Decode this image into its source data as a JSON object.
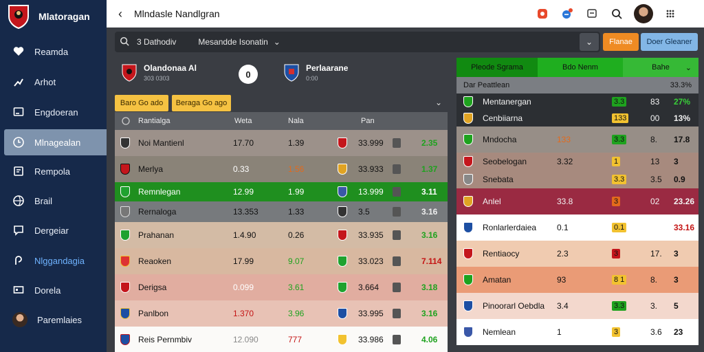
{
  "app": {
    "name": "Mlatoragan"
  },
  "sidebar": {
    "items": [
      {
        "label": "Reamda",
        "icon": "heart-icon"
      },
      {
        "label": "Arhot",
        "icon": "share-icon"
      },
      {
        "label": "Engdoeran",
        "icon": "monitor-icon"
      },
      {
        "label": "Mlnagealan",
        "icon": "clock-icon"
      },
      {
        "label": "Rempola",
        "icon": "copy-icon"
      },
      {
        "label": "Brail",
        "icon": "globe-icon"
      },
      {
        "label": "Dergeiar",
        "icon": "chat-icon"
      },
      {
        "label": "Nlggandagia",
        "icon": "pin-icon"
      },
      {
        "label": "Dorela",
        "icon": "screen-icon"
      },
      {
        "label": "Paremlaies",
        "icon": "user-avatar"
      }
    ]
  },
  "topbar": {
    "title": "Mlndasle Nandlgran"
  },
  "toolbar": {
    "label": "3  Dathodiv",
    "select_value": "Mesandde Isonatin",
    "btn_orange": "Flanae",
    "btn_blue": "Doer Gleaner"
  },
  "match": {
    "home": {
      "name": "Olandonaa Al",
      "sub": "303 0303"
    },
    "away": {
      "name": "Perlaarane",
      "sub": "0:00"
    },
    "vs": "0"
  },
  "filters": {
    "chip1": "Baro Go ado",
    "chip2": "Beraga Go ago"
  },
  "left_table": {
    "headers": [
      "Rantialga",
      "Weta",
      "Nala",
      "Pan"
    ],
    "rows": [
      {
        "name": "Noi  Mantienl",
        "c1": "17.70",
        "c2": "1.39",
        "c3": "33.999",
        "c4": "2.35",
        "bg": "#9c918a",
        "h": 38
      },
      {
        "name": "Merlya",
        "c1": "0.33",
        "c2": "1.56",
        "c3": "33.933",
        "c4": "1.37",
        "bg": "#8a8378",
        "h": 38
      },
      {
        "name": "Remnlegan",
        "c1": "12.99",
        "c2": "1.99",
        "c3": "13.999",
        "c4": "3.11",
        "bg": "#1f8f1f",
        "h": 28
      },
      {
        "name": "Rernaloga",
        "c1": "13.353",
        "c2": "1.33",
        "c3": "3.5",
        "c4": "3.16",
        "bg": "#777a7d",
        "h": 30
      },
      {
        "name": "Prahanan",
        "c1": "1.4.90",
        "c2": "0.26",
        "c3": "33.935",
        "c4": "3.16",
        "bg": "#d3bba5",
        "h": 38
      },
      {
        "name": "Reaoken",
        "c1": "17.99",
        "c2": "9.07",
        "c3": "33.023",
        "c4": "7.114",
        "bg": "#d8b8a0",
        "h": 38
      },
      {
        "name": "Derigsa",
        "c1": "0.099",
        "c2": "3.61",
        "c3": "3.664",
        "c4": "3.18",
        "bg": "#e1ada0",
        "h": 38
      },
      {
        "name": "Panlbon",
        "c1": "1.370",
        "c2": "3.96",
        "c3": "33.995",
        "c4": "3.16",
        "bg": "#e8c2b5",
        "h": 38
      },
      {
        "name": "Reis  Pernmbiv",
        "c1": "12.090",
        "c2": "777",
        "c3": "33.986",
        "c4": "4.06",
        "bg": "#fbfaf8",
        "h": 38
      }
    ]
  },
  "right_panel": {
    "tabs": [
      "Pleode Sgrama",
      "Bdo Nenm",
      "Bahe"
    ],
    "header_row": {
      "label": "Dar  Peattlean",
      "value": "33.3%"
    },
    "rows": [
      {
        "name": "Mentanergan",
        "a": "",
        "b": "3.3",
        "c": "83",
        "d": "27%",
        "bg": "#2c2f33"
      },
      {
        "name": "Cenbiiarna",
        "a": "",
        "b": "133",
        "c": "00",
        "d": "13%",
        "bg": "#2c2f33"
      },
      {
        "name": "Mndocha",
        "a": "133",
        "b": "3.3",
        "c": "8.",
        "d": "17.8",
        "bg": "#978e87"
      },
      {
        "name": "Seobelogan",
        "a": "3.32",
        "b": "1",
        "c": "13",
        "d": "3",
        "bg": "#a78a7e"
      },
      {
        "name": "Snebata",
        "a": "",
        "b": "3.3",
        "c": "3.5",
        "d": "0.9",
        "bg": "#a78a7e"
      },
      {
        "name": "Anlel",
        "a": "33.8",
        "b": "3",
        "c": "02",
        "d": "23.26",
        "bg": "#9a2a42"
      },
      {
        "name": "Ronlarlerdaiea",
        "a": "0.1",
        "b": "0.1",
        "c": "",
        "d": "33.16",
        "bg": "#ffffff"
      },
      {
        "name": "Rentiaocy",
        "a": "2.3",
        "b": "3",
        "c": "17.",
        "d": "3",
        "bg": "#f0cbb0"
      },
      {
        "name": "Amatan",
        "a": "93",
        "b": "8 1",
        "c": "8.",
        "d": "3",
        "bg": "#ea9b76"
      },
      {
        "name": "Pinoorarl Oebdla",
        "a": "3.4",
        "b": "3.3",
        "c": "3.",
        "d": "5",
        "bg": "#f3d8cd"
      },
      {
        "name": "Nemlean",
        "a": "1",
        "b": "3",
        "c": "3.6",
        "d": "23",
        "bg": "#ffffff"
      }
    ]
  },
  "colors": {
    "sidebar": "#16294a",
    "accent_orange": "#ef8b23",
    "accent_blue": "#82b6e6",
    "green_tab": "#118a11",
    "red_value": "#d81b1b"
  }
}
